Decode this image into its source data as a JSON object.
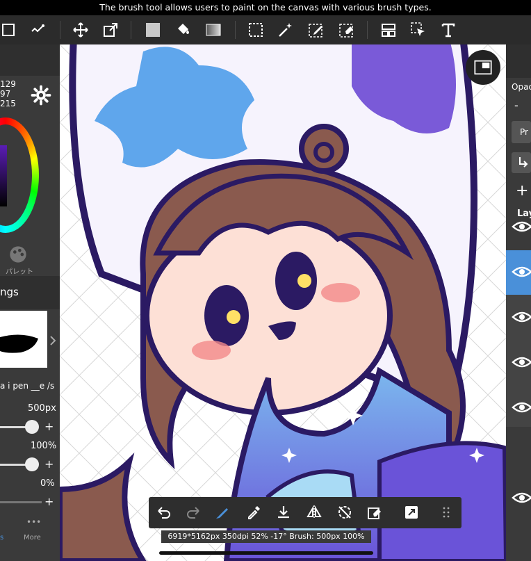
{
  "caption": "The brush tool allows users to paint on the canvas with various brush types.",
  "color_values": {
    "r": "129",
    "g": "97",
    "b": "215"
  },
  "left_panel": {
    "palette_label": "パレット",
    "section_title": "ngs",
    "brush_name": "a i pen __e /s",
    "size_value": "500px",
    "opacity_value": "100%",
    "third_value": "0%",
    "more_label": "More",
    "tab_partial": "s"
  },
  "right_panel": {
    "opacity_label": "Opac",
    "blend_label": "Pr",
    "layer_label": "Lay"
  },
  "status_bar": "6919*5162px 350dpi 52% -17° Brush: 500px 100%",
  "colors": {
    "accent": "#4a90d9",
    "toolbar_bg": "#2b2b2b",
    "panel_bg": "#3a3a3a",
    "primary_color": "#8161d7"
  },
  "icons": {
    "toolbar": [
      "select-rect-icon",
      "brush-transform-icon",
      "move-icon",
      "transform-icon",
      "fill-color-icon",
      "bucket-icon",
      "gradient-icon",
      "lasso-select-icon",
      "magic-wand-icon",
      "select-pen-icon",
      "select-eraser-icon",
      "layer-move-icon",
      "select-cursor-icon",
      "text-icon"
    ],
    "bottom_bar": [
      "undo-icon",
      "redo-icon",
      "brush-active-icon",
      "eyedropper-icon",
      "save-icon",
      "flip-icon",
      "rotate-reset-icon",
      "clear-icon",
      "share-icon",
      "more-grid-icon"
    ]
  }
}
